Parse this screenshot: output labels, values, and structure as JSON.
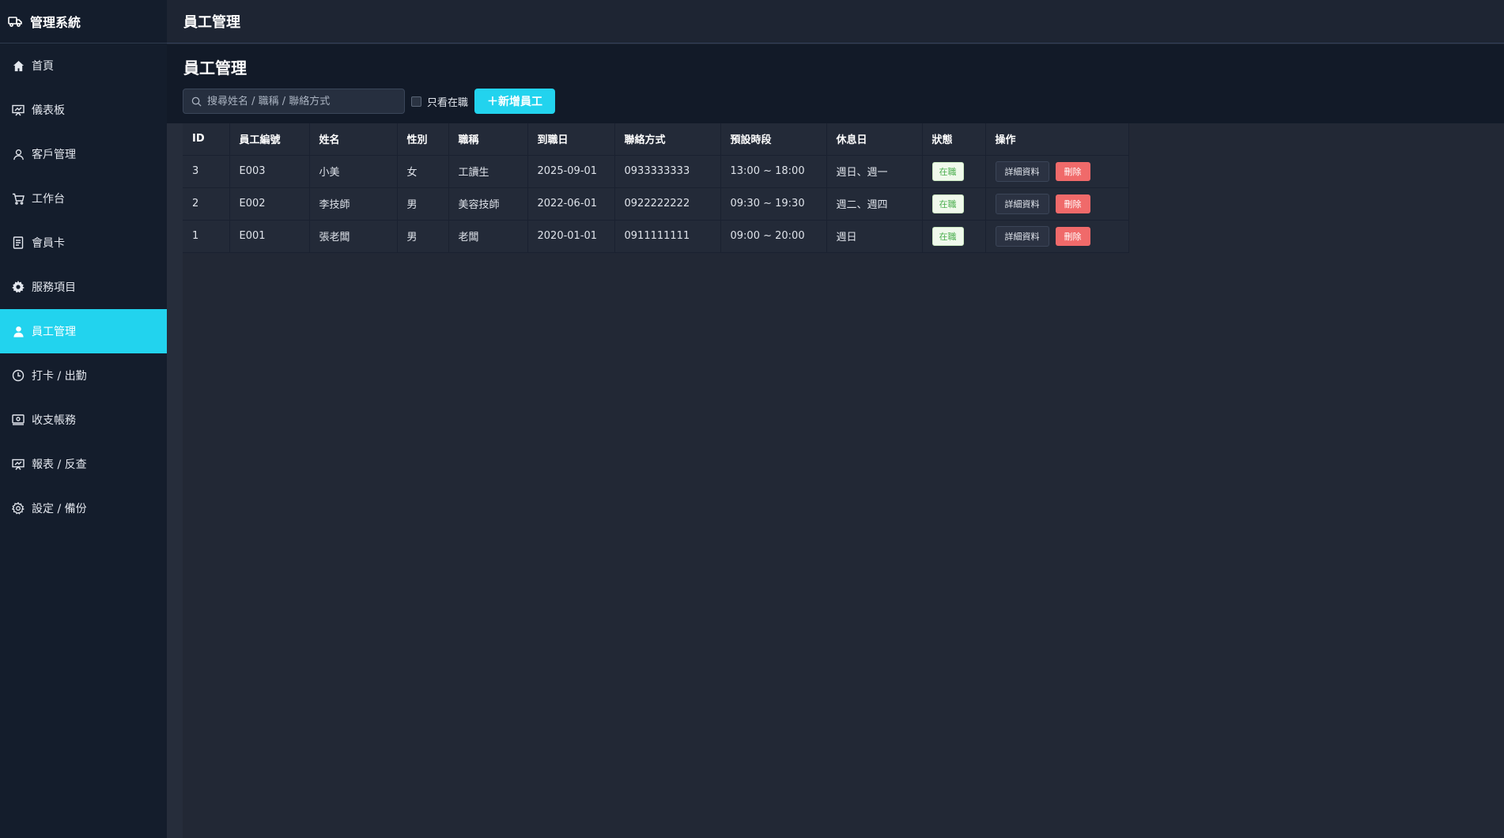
{
  "brand": {
    "title": "管理系統",
    "icon": "truck-icon"
  },
  "sidebar": {
    "items": [
      {
        "label": "首頁",
        "icon": "home-icon"
      },
      {
        "label": "儀表板",
        "icon": "dashboard-icon"
      },
      {
        "label": "客戶管理",
        "icon": "user-icon"
      },
      {
        "label": "工作台",
        "icon": "cart-icon"
      },
      {
        "label": "會員卡",
        "icon": "document-icon"
      },
      {
        "label": "服務項目",
        "icon": "gear-icon"
      },
      {
        "label": "員工管理",
        "icon": "person-icon",
        "active": true
      },
      {
        "label": "打卡 / 出勤",
        "icon": "clock-icon"
      },
      {
        "label": "收支帳務",
        "icon": "wallet-icon"
      },
      {
        "label": "報表 / 反查",
        "icon": "report-icon"
      },
      {
        "label": "設定 / 備份",
        "icon": "settings-icon"
      }
    ]
  },
  "topbar": {
    "title": "員工管理"
  },
  "page": {
    "title": "員工管理",
    "search_placeholder": "搜尋姓名 / 職稱 / 聯絡方式",
    "only_active_label": "只看在職",
    "add_button": "＋新增員工"
  },
  "table": {
    "headers": [
      "ID",
      "員工編號",
      "姓名",
      "性別",
      "職稱",
      "到職日",
      "聯絡方式",
      "預設時段",
      "休息日",
      "狀態",
      "操作"
    ],
    "rows": [
      {
        "id": "3",
        "code": "E003",
        "name": "小美",
        "gender": "女",
        "title": "工讀生",
        "start": "2025-09-01",
        "contact": "0933333333",
        "shift": "13:00 ~ 18:00",
        "rest": "週日、週一",
        "status": "在職",
        "detail": "詳細資料",
        "delete": "刪除"
      },
      {
        "id": "2",
        "code": "E002",
        "name": "李技師",
        "gender": "男",
        "title": "美容技師",
        "start": "2022-06-01",
        "contact": "0922222222",
        "shift": "09:30 ~ 19:30",
        "rest": "週二、週四",
        "status": "在職",
        "detail": "詳細資料",
        "delete": "刪除"
      },
      {
        "id": "1",
        "code": "E001",
        "name": "張老闆",
        "gender": "男",
        "title": "老闆",
        "start": "2020-01-01",
        "contact": "0911111111",
        "shift": "09:00 ~ 20:00",
        "rest": "週日",
        "status": "在職",
        "detail": "詳細資料",
        "delete": "刪除"
      }
    ]
  },
  "colors": {
    "accent": "#22d3ee",
    "danger": "#f06a6a",
    "sidebar_bg": "#141d2c"
  }
}
